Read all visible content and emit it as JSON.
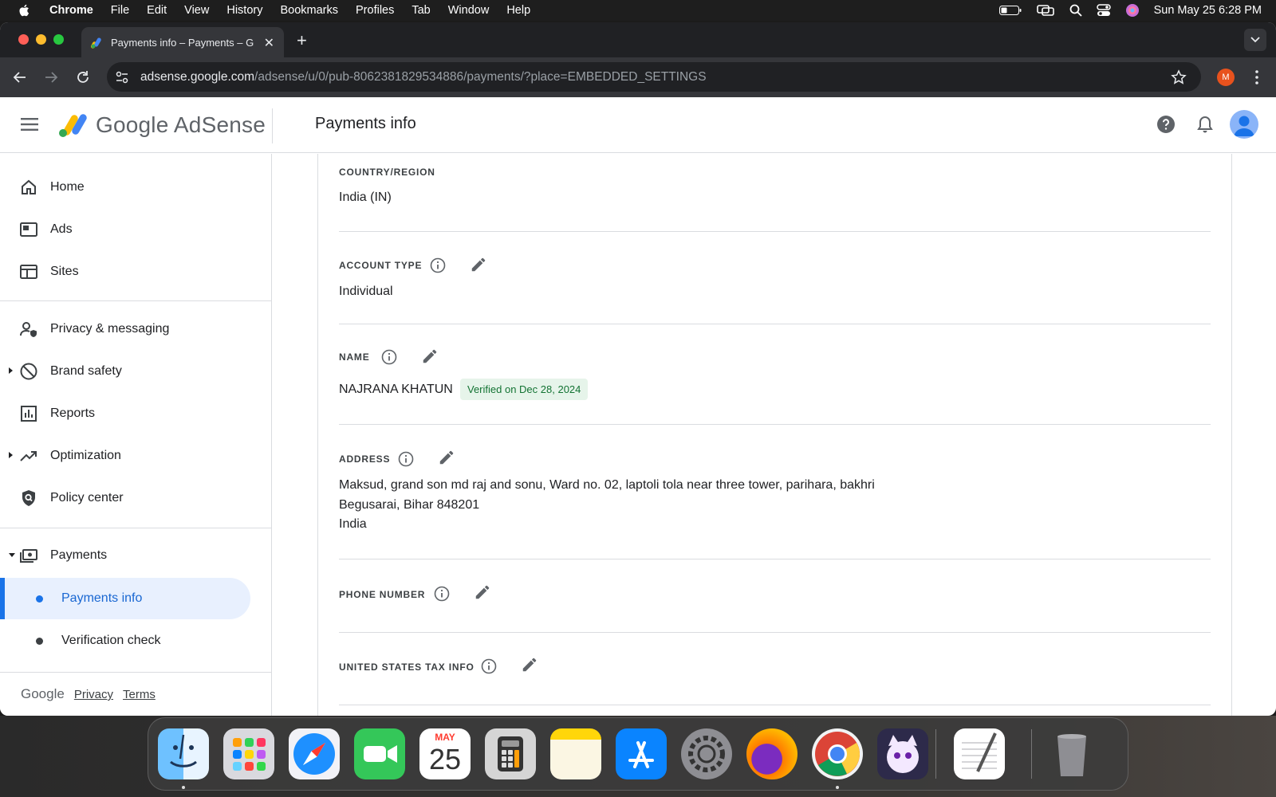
{
  "menubar": {
    "app": "Chrome",
    "items": [
      "File",
      "Edit",
      "View",
      "History",
      "Bookmarks",
      "Profiles",
      "Tab",
      "Window",
      "Help"
    ],
    "datetime": "Sun May 25  6:28 PM"
  },
  "browser": {
    "tab_title": "Payments info – Payments – G",
    "url_host": "adsense.google.com",
    "url_path": "/adsense/u/0/pub-8062381829534886/payments/?place=EMBEDDED_SETTINGS",
    "profile_initial": "M"
  },
  "header": {
    "logo_text": "Google AdSense",
    "page_title": "Payments info"
  },
  "sidebar": {
    "items": [
      {
        "label": "Home",
        "icon": "home-icon"
      },
      {
        "label": "Ads",
        "icon": "ads-icon"
      },
      {
        "label": "Sites",
        "icon": "sites-icon"
      },
      {
        "label": "Privacy & messaging",
        "icon": "privacy-icon"
      },
      {
        "label": "Brand safety",
        "icon": "block-icon"
      },
      {
        "label": "Reports",
        "icon": "bar-chart-icon"
      },
      {
        "label": "Optimization",
        "icon": "trending-icon"
      },
      {
        "label": "Policy center",
        "icon": "shield-icon"
      },
      {
        "label": "Payments",
        "icon": "payments-icon"
      }
    ],
    "sub_items": [
      {
        "label": "Payments info",
        "active": true
      },
      {
        "label": "Verification check",
        "active": false
      }
    ],
    "footer": {
      "brand": "Google",
      "privacy": "Privacy",
      "terms": "Terms"
    }
  },
  "fields": {
    "country": {
      "label": "COUNTRY/REGION",
      "value": "India (IN)"
    },
    "account_type": {
      "label": "ACCOUNT TYPE",
      "value": "Individual"
    },
    "name": {
      "label": "NAME",
      "value": "NAJRANA KHATUN",
      "badge": "Verified on Dec 28, 2024"
    },
    "address": {
      "label": "ADDRESS",
      "line1": "Maksud, grand son md raj and sonu, Ward no. 02, laptoli tola near three tower, parihara, bakhri",
      "line2": "Begusarai, Bihar 848201",
      "line3": "India"
    },
    "phone": {
      "label": "PHONE NUMBER"
    },
    "us_tax": {
      "label": "UNITED STATES TAX INFO"
    }
  },
  "dock": {
    "calendar_month": "MAY",
    "calendar_day": "25",
    "apps": [
      "Finder",
      "Launchpad",
      "Safari",
      "FaceTime",
      "Calendar",
      "Calculator",
      "Notes",
      "App Store",
      "System Settings",
      "Firefox",
      "Chrome",
      "Furball",
      "TextEdit",
      "Trash"
    ]
  },
  "colors": {
    "accent": "#1a73e8",
    "active_bg": "#e8f0fe",
    "verified_bg": "#e6f4ea",
    "verified_text": "#137333"
  }
}
